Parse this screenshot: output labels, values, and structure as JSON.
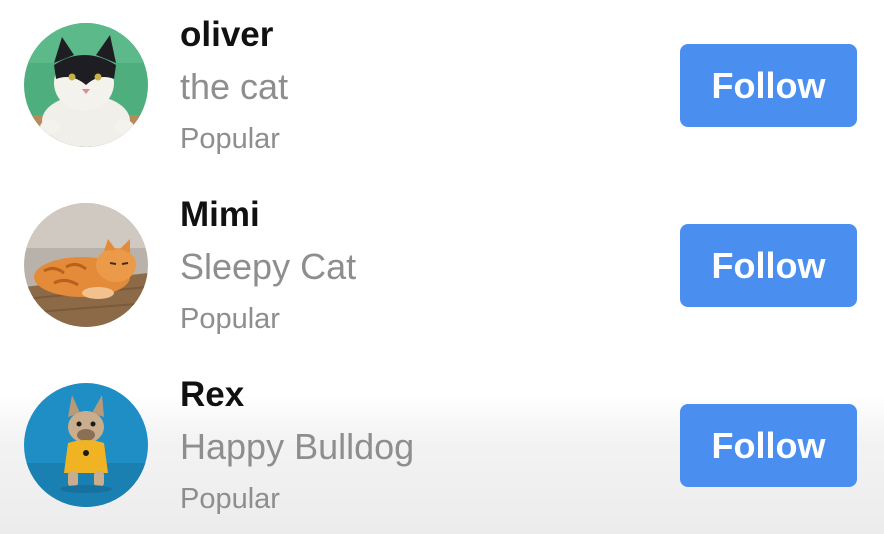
{
  "users": [
    {
      "name": "oliver",
      "description": "the cat",
      "tag": "Popular",
      "follow_label": "Follow",
      "avatar_icon": "tuxedo-cat-photo"
    },
    {
      "name": "Mimi",
      "description": "Sleepy Cat",
      "tag": "Popular",
      "follow_label": "Follow",
      "avatar_icon": "orange-tabby-cat-photo"
    },
    {
      "name": "Rex",
      "description": "Happy Bulldog",
      "tag": "Popular",
      "follow_label": "Follow",
      "avatar_icon": "french-bulldog-photo"
    }
  ],
  "colors": {
    "button": "#4a8ff0",
    "button_text": "#ffffff",
    "name_text": "#111111",
    "secondary_text": "#8e8e8e"
  }
}
